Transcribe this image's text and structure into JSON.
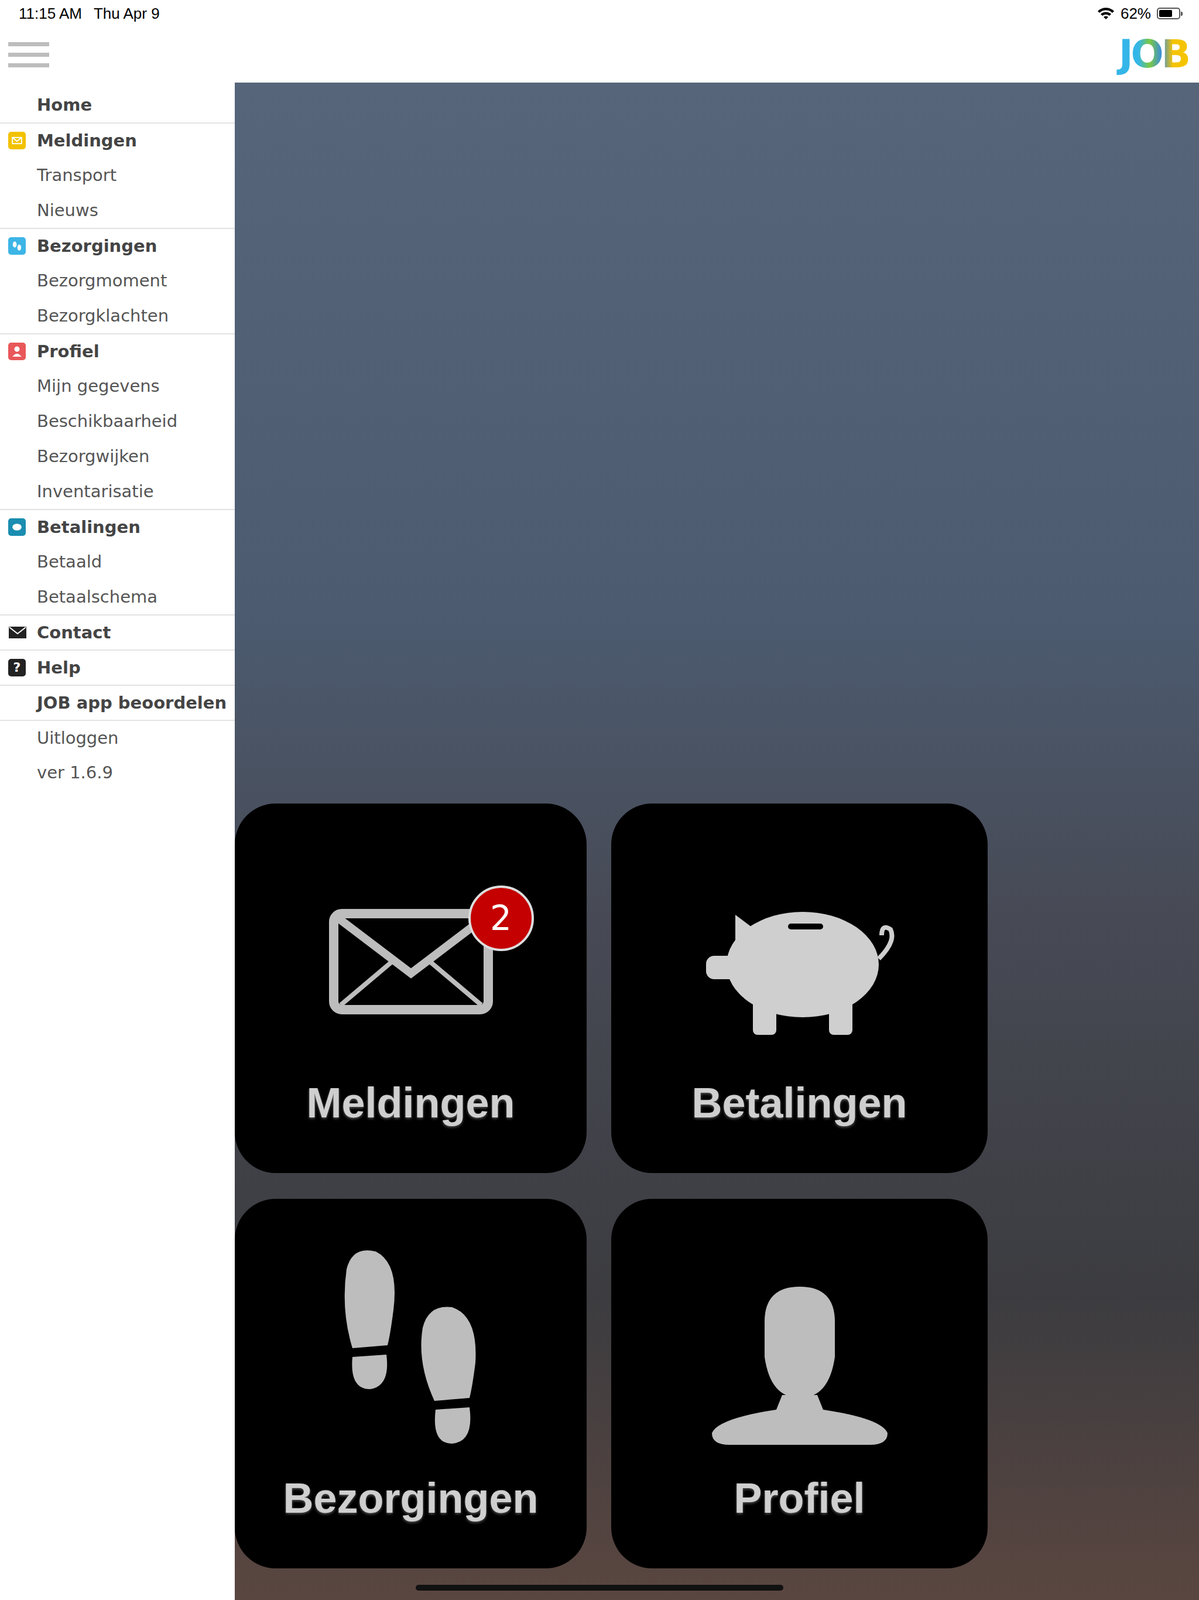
{
  "status_bar": {
    "time": "11:15 AM",
    "date": "Thu Apr 9",
    "battery": "62%",
    "battery_level": 0.62
  },
  "header": {
    "logo": "JOB"
  },
  "sidebar": {
    "items": [
      {
        "label": "Home",
        "kind": "header"
      },
      {
        "label": "Meldingen",
        "kind": "header",
        "color": "#f2c200"
      },
      {
        "label": "Transport",
        "kind": "item"
      },
      {
        "label": "Nieuws",
        "kind": "item"
      },
      {
        "label": "Bezorgingen",
        "kind": "header",
        "color": "#3db5e6"
      },
      {
        "label": "Bezorgmoment",
        "kind": "item"
      },
      {
        "label": "Bezorgklachten",
        "kind": "item"
      },
      {
        "label": "Profiel",
        "kind": "header",
        "color": "#e8585a"
      },
      {
        "label": "Mijn gegevens",
        "kind": "item"
      },
      {
        "label": "Beschikbaarheid",
        "kind": "item"
      },
      {
        "label": "Bezorgwijken",
        "kind": "item"
      },
      {
        "label": "Inventarisatie",
        "kind": "item"
      },
      {
        "label": "Betalingen",
        "kind": "header",
        "color": "#1a8db0"
      },
      {
        "label": "Betaald",
        "kind": "item"
      },
      {
        "label": "Betaalschema",
        "kind": "item"
      },
      {
        "label": "Contact",
        "kind": "header",
        "color": "#222222"
      },
      {
        "label": "Help",
        "kind": "header",
        "color": "#222222",
        "glyph": "?"
      },
      {
        "label": "JOB app beoordelen",
        "kind": "header"
      },
      {
        "label": "Uitloggen",
        "kind": "footer"
      },
      {
        "label": "ver 1.6.9",
        "kind": "footer"
      }
    ]
  },
  "tiles": [
    {
      "label": "Meldingen",
      "badge": "2"
    },
    {
      "label": "Betalingen"
    },
    {
      "label": "Bezorgingen"
    },
    {
      "label": "Profiel"
    }
  ]
}
